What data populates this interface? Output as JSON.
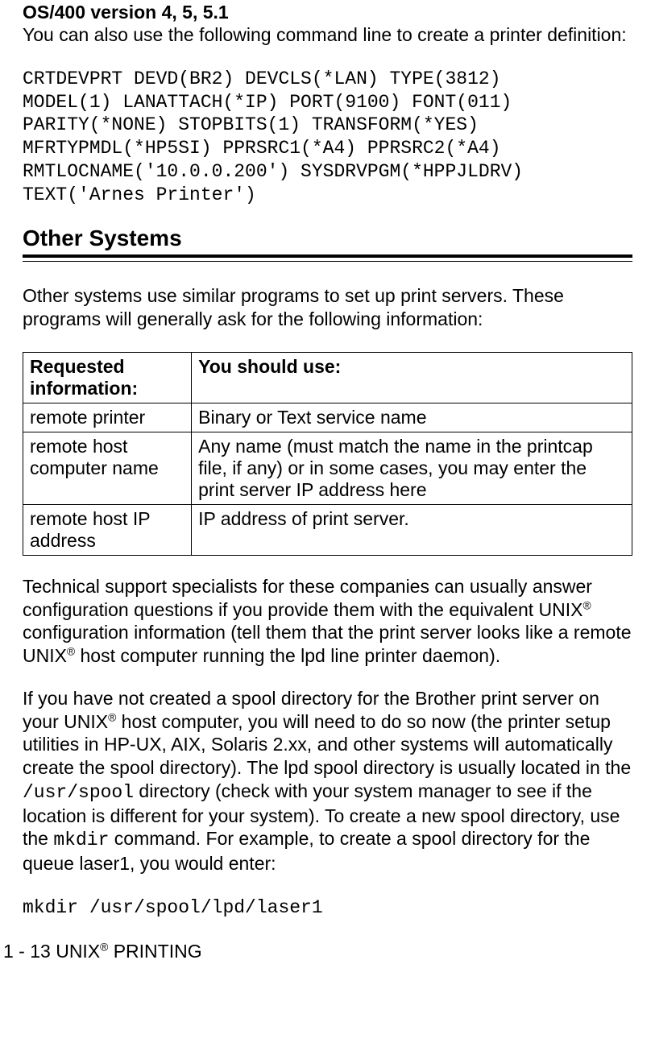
{
  "os_heading": "OS/400 version 4, 5, 5.1",
  "os_intro": "You can also use the following command line to create a printer definition:",
  "crtdevprt": "CRTDEVPRT DEVD(BR2) DEVCLS(*LAN) TYPE(3812)\nMODEL(1) LANATTACH(*IP) PORT(9100) FONT(011)\nPARITY(*NONE) STOPBITS(1) TRANSFORM(*YES)\nMFRTYPMDL(*HP5SI) PPRSRC1(*A4) PPRSRC2(*A4)\nRMTLOCNAME('10.0.0.200') SYSDRVPGM(*HPPJLDRV)\nTEXT('Arnes Printer')",
  "other_systems_title": "Other Systems",
  "other_systems_intro": "Other systems use similar programs to set up print servers. These programs will generally ask for the following information:",
  "table": {
    "header": {
      "c1": "Requested information:",
      "c2": "You should use:"
    },
    "rows": [
      {
        "c1": "remote printer",
        "c2": "Binary or Text service name"
      },
      {
        "c1": "remote host computer name",
        "c2": "Any name (must match the name in the printcap file, if any) or in some cases, you may enter the print server IP address here"
      },
      {
        "c1": "remote host IP address",
        "c2": "IP address of print server."
      }
    ]
  },
  "tech_support": {
    "p1a": "Technical support specialists for these companies can usually answer configuration questions if you provide them with the equivalent UNIX",
    "reg1": "®",
    "p1b": " configuration information (tell them that the print server looks like a remote UNIX",
    "reg2": "®",
    "p1c": " host computer running the lpd line printer daemon)."
  },
  "spool": {
    "p2a": "If you have not created a spool directory for the Brother print server on your UNIX",
    "reg3": "®",
    "p2b": " host computer, you will need to do so now (the printer setup utilities in HP-UX, AIX, Solaris 2.xx, and other systems will automatically create the spool directory). The lpd spool directory is usually located in the ",
    "code1": "/usr/spool",
    "p2c": " directory (check with your system manager to see if the location is different for your system). To create a new spool directory, use the ",
    "code2": "mkdir",
    "p2d": " command. For example, to create a spool directory for the queue laser1, you would enter:"
  },
  "mkdir_cmd": "mkdir /usr/spool/lpd/laser1",
  "footer": {
    "a": "1 - 13 UNIX",
    "reg": "®",
    "b": " PRINTING"
  }
}
